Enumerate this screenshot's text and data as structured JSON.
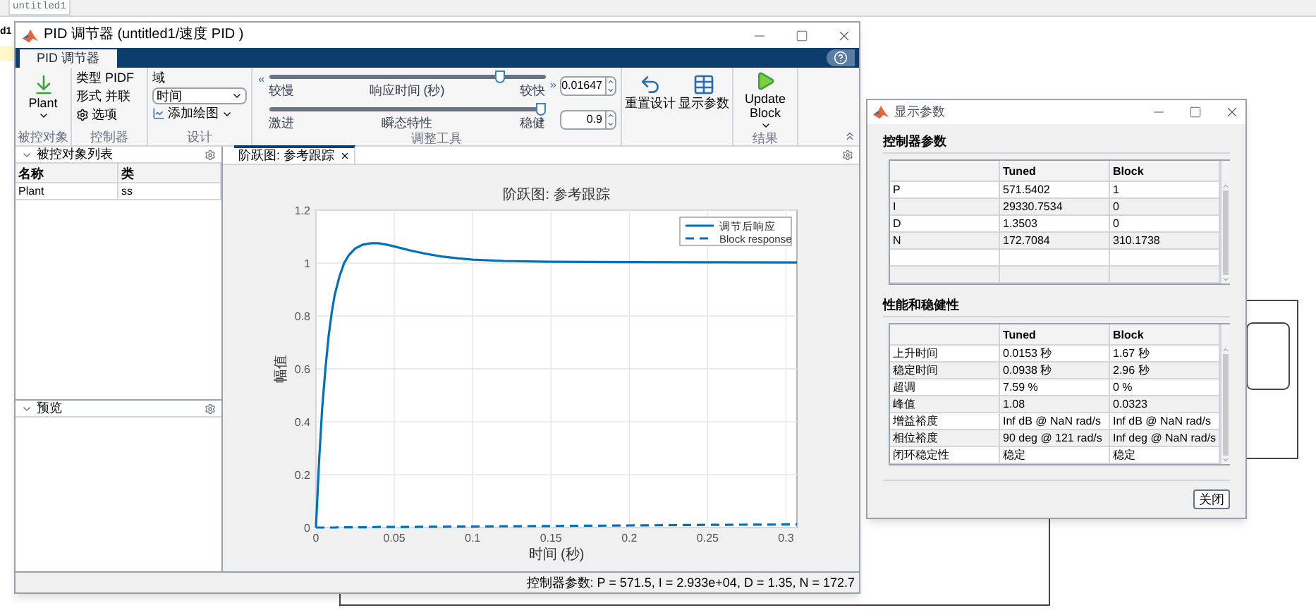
{
  "desktop": {
    "tab": "untitled1",
    "side_text": "d1"
  },
  "main_window": {
    "title": "PID 调节器 (untitled1/速度 PID )",
    "tabs": [
      {
        "label": "PID 调节器",
        "selected": true
      }
    ],
    "ribbon": {
      "plant": {
        "label": "Plant",
        "group": "被控对象"
      },
      "controller": {
        "type_label": "类型",
        "type_value": "PIDF",
        "form_label": "形式",
        "form_value": "并联",
        "options": "选项",
        "group": "控制器"
      },
      "design": {
        "domain_label": "域",
        "domain_value": "时间",
        "add_plot": "添加绘图",
        "group": "设计"
      },
      "tuning": {
        "group": "调整工具",
        "sliders": [
          {
            "left": "较慢",
            "center": "响应时间 (秒)",
            "right": "较快",
            "level": 0.85,
            "value": "0.01647"
          },
          {
            "left": "激进",
            "center": "瞬态特性",
            "right": "稳健",
            "level": 1,
            "value": "0.9"
          }
        ]
      },
      "reset": "重置设计",
      "show_params": "显示参数",
      "update": {
        "label": "Update Block",
        "group": "结果"
      }
    },
    "plant_list": {
      "title": "被控对象列表",
      "columns": [
        "名称",
        "类"
      ],
      "rows": [
        [
          "Plant",
          "ss"
        ]
      ]
    },
    "preview": {
      "title": "预览"
    },
    "plot_tabs": [
      {
        "label": "阶跃图: 参考跟踪",
        "selected": true
      }
    ],
    "chart_data": {
      "type": "line",
      "title": "阶跃图: 参考跟踪",
      "xlabel": "时间 (秒)",
      "ylabel": "幅值",
      "x": [
        0,
        0.002,
        0.004,
        0.006,
        0.008,
        0.01,
        0.012,
        0.015,
        0.018,
        0.021,
        0.025,
        0.03,
        0.035,
        0.04,
        0.045,
        0.05,
        0.06,
        0.07,
        0.08,
        0.09,
        0.1,
        0.12,
        0.15,
        0.2,
        0.25,
        0.307
      ],
      "series": [
        {
          "name": "调节后响应",
          "color": "#0072bd",
          "line_style": "solid",
          "values": [
            0,
            0.25,
            0.45,
            0.6,
            0.72,
            0.81,
            0.88,
            0.95,
            1.0,
            1.03,
            1.055,
            1.07,
            1.075,
            1.075,
            1.07,
            1.063,
            1.048,
            1.035,
            1.025,
            1.018,
            1.013,
            1.008,
            1.005,
            1.004,
            1.003,
            1.002
          ]
        },
        {
          "name": "Block response",
          "color": "#0072bd",
          "line_style": "dashed",
          "values": [
            0,
            0,
            0,
            0,
            0,
            0,
            0,
            0.001,
            0.001,
            0.001,
            0.001,
            0.001,
            0.001,
            0.002,
            0.002,
            0.002,
            0.002,
            0.003,
            0.003,
            0.004,
            0.004,
            0.005,
            0.006,
            0.008,
            0.01,
            0.012
          ]
        }
      ],
      "xlim": [
        0,
        0.307
      ],
      "ylim": [
        0,
        1.2
      ],
      "grid": true,
      "legend": true,
      "xticks": [
        0,
        0.05,
        0.1,
        0.15,
        0.2,
        0.25,
        0.3
      ],
      "yticks": [
        0,
        0.2,
        0.4,
        0.6,
        0.8,
        1,
        1.2
      ]
    },
    "status": "控制器参数: P = 571.5, I = 2.933e+04, D = 1.35, N = 172.7"
  },
  "dialog": {
    "title": "显示参数",
    "sections": [
      {
        "title": "控制器参数",
        "columns": [
          "",
          "Tuned",
          "Block"
        ],
        "rows": [
          [
            "P",
            "571.5402",
            "1"
          ],
          [
            "I",
            "29330.7534",
            "0"
          ],
          [
            "D",
            "1.3503",
            "0"
          ],
          [
            "N",
            "172.7084",
            "310.1738"
          ]
        ]
      },
      {
        "title": "性能和稳健性",
        "columns": [
          "",
          "Tuned",
          "Block"
        ],
        "rows": [
          [
            "上升时间",
            "0.0153 秒",
            "1.67 秒"
          ],
          [
            "稳定时间",
            "0.0938 秒",
            "2.96 秒"
          ],
          [
            "超调",
            "7.59 %",
            "0 %"
          ],
          [
            "峰值",
            "1.08",
            "0.0323"
          ],
          [
            "增益裕度",
            "Inf dB @ NaN rad/s",
            "Inf dB @ NaN rad/s"
          ],
          [
            "相位裕度",
            "90 deg @ 121 rad/s",
            "Inf deg @ NaN rad/s"
          ],
          [
            "闭环稳定性",
            "稳定",
            "稳定"
          ]
        ]
      }
    ],
    "close_button": "关闭"
  }
}
